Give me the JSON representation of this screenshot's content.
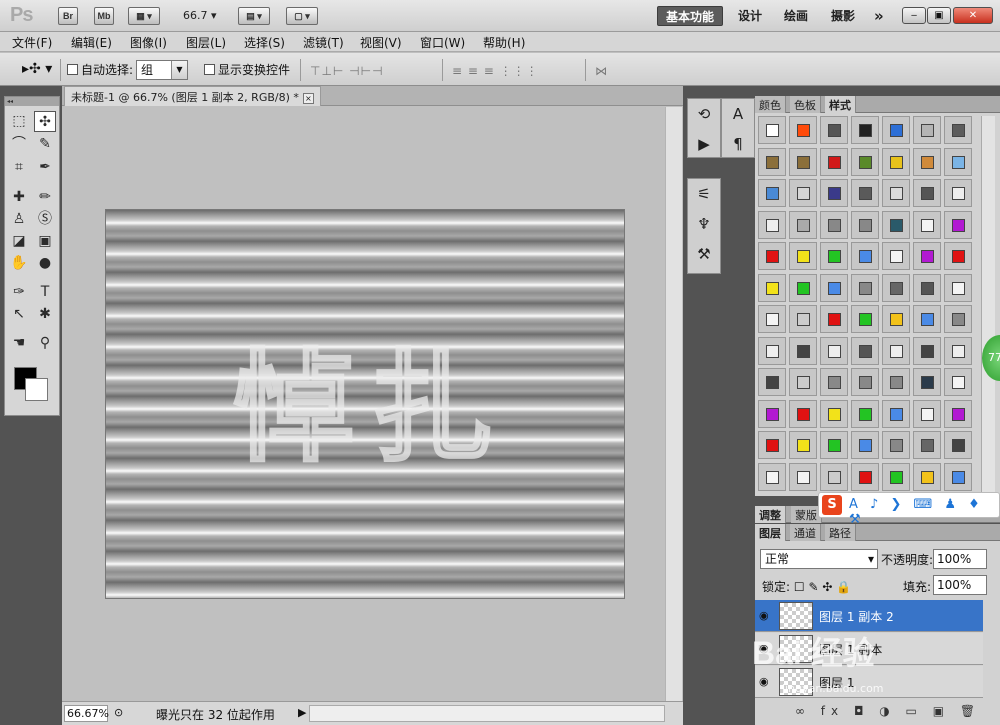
{
  "app": {
    "logo": "Ps",
    "bridge_btn": "Br",
    "minibridge_btn": "Mb",
    "zoom_level": "66.7",
    "workspaces": [
      "基本功能",
      "设计",
      "绘画",
      "摄影"
    ],
    "more": "»",
    "win_min": "‒",
    "win_max": "▣",
    "win_close": "✕"
  },
  "menu": [
    "文件(F)",
    "编辑(E)",
    "图像(I)",
    "图层(L)",
    "选择(S)",
    "滤镜(T)",
    "视图(V)",
    "窗口(W)",
    "帮助(H)"
  ],
  "options": {
    "auto_select_label": "自动选择:",
    "auto_select_value": "组",
    "show_transform_label": "显示变换控件",
    "align_icons_1": "⊤⊥⊢ ⊣⊢⊣",
    "align_icons_2": "≡ ≡ ≡  ⋮⋮⋮",
    "auto_align": "⋈"
  },
  "document": {
    "tab_title": "未标题-1 @ 66.7% (图层 1 副本 2, RGB/8) *",
    "close": "×",
    "canvas_text": "悼扎",
    "zoom": "66.67%",
    "status": "曝光只在 32 位起作用"
  },
  "panels": {
    "tabs": [
      "颜色",
      "色板",
      "样式"
    ],
    "adjust_tabs": [
      "调整",
      "蒙版"
    ],
    "layer_tabs": [
      "图层",
      "通道",
      "路径"
    ],
    "blend_mode": "正常",
    "opacity_label": "不透明度:",
    "opacity_value": "100%",
    "lock_label": "锁定:",
    "fill_label": "填充:",
    "fill_value": "100%",
    "layers": [
      {
        "name": "图层 1 副本 2",
        "active": true
      },
      {
        "name": "图层 1 副本",
        "active": false
      },
      {
        "name": "图层 1",
        "active": false
      }
    ],
    "style_colors": [
      "#ffffff",
      "#ff4b0a",
      "#555555",
      "#222222",
      "#2d6fd6",
      "#b4b4b4",
      "#5c5c5c",
      "#8b6f3a",
      "#8b6f3a",
      "#d21a1a",
      "#5a8a2a",
      "#e8c21b",
      "#d08a3a",
      "#7ab4e6",
      "#4a8ad6",
      "#d6d6d6",
      "#3a3a8a",
      "#5a5a5a",
      "#dcdcdc",
      "#555555",
      "#eeeeee",
      "#eeeeee",
      "#aaaaaa",
      "#888888",
      "#888888",
      "#2a5a6a",
      "#f4f4f4",
      "#b21ad2",
      "#e01212",
      "#f2e21a",
      "#23c423",
      "#4a8ae6",
      "#f4f4f4",
      "#b21ad2",
      "#e01212",
      "#f2e21a",
      "#23c423",
      "#4a8ae6",
      "#888888",
      "#666666",
      "#555555",
      "#f4f4f4",
      "#f4f4f4",
      "#cccccc",
      "#e01212",
      "#23c423",
      "#f2c21a",
      "#4a8ae6",
      "#888888",
      "#eeeeee",
      "#444444",
      "#eeeeee",
      "#555555",
      "#eeeeee",
      "#444444",
      "#eeeeee",
      "#444444",
      "#cccccc",
      "#888888",
      "#888888",
      "#888888",
      "#2a3a4a",
      "#f4f4f4",
      "#b21ad2",
      "#e01212",
      "#f2e21a",
      "#23c423",
      "#4a8ae6",
      "#f4f4f4",
      "#b21ad2",
      "#e01212",
      "#f2e21a",
      "#23c423",
      "#4a8ae6",
      "#888888",
      "#666666",
      "#444444",
      "#f4f4f4",
      "#f4f4f4",
      "#cccccc",
      "#e01212",
      "#23c423",
      "#f2c21a",
      "#4a8ae6"
    ]
  },
  "overlays": {
    "sogou_s": "S",
    "sogou_icons": "A ♪ ❯ ⌨ ♟ ♦ ⚒",
    "badge": "77",
    "watermark": "Bai 经验",
    "watermark_url": "jingyan.baidu.com"
  }
}
